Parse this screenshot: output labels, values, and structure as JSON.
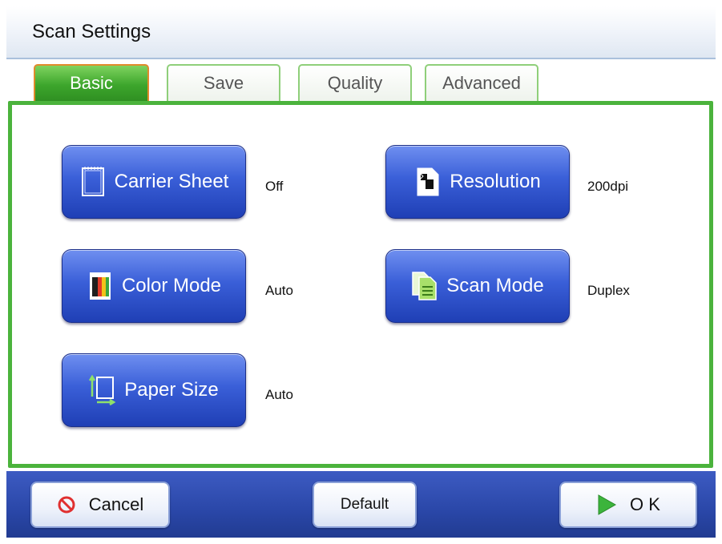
{
  "header": {
    "title": "Scan Settings"
  },
  "tabs": [
    {
      "label": "Basic",
      "active": true
    },
    {
      "label": "Save",
      "active": false
    },
    {
      "label": "Quality",
      "active": false
    },
    {
      "label": "Advanced",
      "active": false
    }
  ],
  "settings": {
    "carrier_sheet": {
      "label": "Carrier Sheet",
      "value": "Off",
      "icon": "document-icon"
    },
    "resolution": {
      "label": "Resolution",
      "value": "200dpi",
      "icon": "resolution-icon"
    },
    "color_mode": {
      "label": "Color Mode",
      "value": "Auto",
      "icon": "color-mode-icon"
    },
    "scan_mode": {
      "label": "Scan Mode",
      "value": "Duplex",
      "icon": "duplex-icon"
    },
    "paper_size": {
      "label": "Paper Size",
      "value": "Auto",
      "icon": "paper-size-icon"
    }
  },
  "footer": {
    "cancel_label": "Cancel",
    "default_label": "Default",
    "ok_label": "O K"
  },
  "colors": {
    "tab_active": "#3da62c",
    "panel_border": "#4bb33c",
    "setting_button": "#3a5fd8",
    "footer_bar": "#2a47a8",
    "cancel_icon": "#e03030",
    "ok_icon": "#3cb43c"
  }
}
